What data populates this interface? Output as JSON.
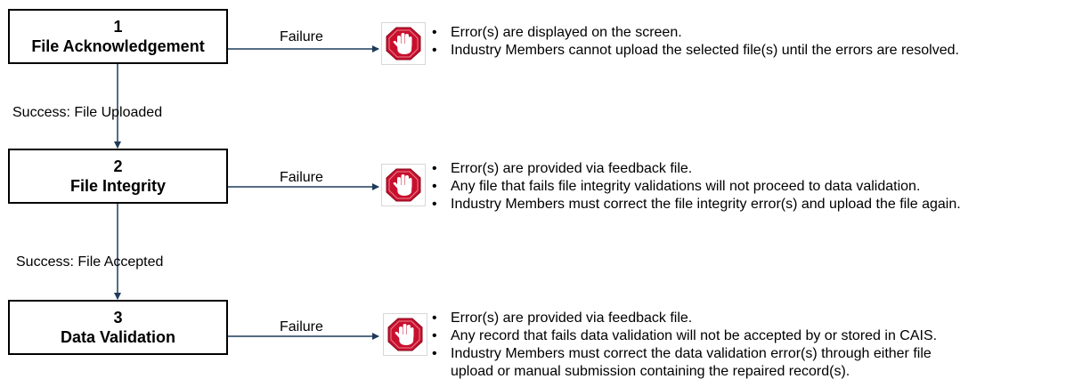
{
  "steps": [
    {
      "number": "1",
      "title": "File Acknowledgement",
      "failure_label": "Failure",
      "stop_icon": "stop-hand-icon",
      "bullets": [
        "Error(s) are displayed on the screen.",
        "Industry Members cannot upload the selected file(s) until the errors are resolved."
      ]
    },
    {
      "number": "2",
      "title": "File Integrity",
      "failure_label": "Failure",
      "stop_icon": "stop-hand-icon",
      "bullets": [
        "Error(s) are provided via feedback file.",
        "Any file that fails file integrity validations will not proceed to data validation.",
        "Industry Members must correct the file integrity error(s) and upload the file again."
      ]
    },
    {
      "number": "3",
      "title": "Data Validation",
      "failure_label": "Failure",
      "stop_icon": "stop-hand-icon",
      "bullets": [
        "Error(s) are provided via feedback file.",
        "Any record that fails data validation will not be accepted by or stored in CAIS.",
        "Industry Members must correct the data validation error(s) through either file",
        "upload or manual submission containing the repaired record(s)."
      ]
    }
  ],
  "transitions": [
    {
      "label": "Success: File Uploaded"
    },
    {
      "label": "Success: File Accepted"
    }
  ],
  "colors": {
    "arrow": "#1f3b5a",
    "stop_red": "#c8102e",
    "box_border": "#000000"
  }
}
